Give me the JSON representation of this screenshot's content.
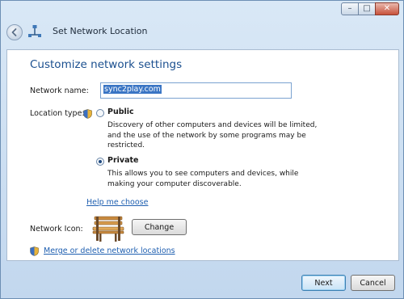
{
  "window": {
    "title": "Set Network Location",
    "controls": {
      "minimize": "–",
      "maximize": "□",
      "close": "✕"
    }
  },
  "page": {
    "heading": "Customize network settings",
    "network_name": {
      "label": "Network name:",
      "value": "sync2play.com"
    },
    "location_type": {
      "label": "Location type:",
      "options": [
        {
          "title": "Public",
          "description": "Discovery of other computers and devices will be limited, and the use of the network by some programs may be restricted.",
          "selected": false
        },
        {
          "title": "Private",
          "description": "This allows you to see computers and devices, while making your computer discoverable.",
          "selected": true
        }
      ]
    },
    "help_link": "Help me choose",
    "network_icon": {
      "label": "Network Icon:",
      "change_button": "Change",
      "icon": "bench-icon"
    },
    "merge_link": "Merge or delete network locations"
  },
  "footer": {
    "next_button": "Next",
    "cancel_button": "Cancel"
  },
  "colors": {
    "heading": "#1a4f8f",
    "link": "#1f5fb0",
    "selection": "#3a75c4",
    "window_frame": "#c2d7ee"
  }
}
